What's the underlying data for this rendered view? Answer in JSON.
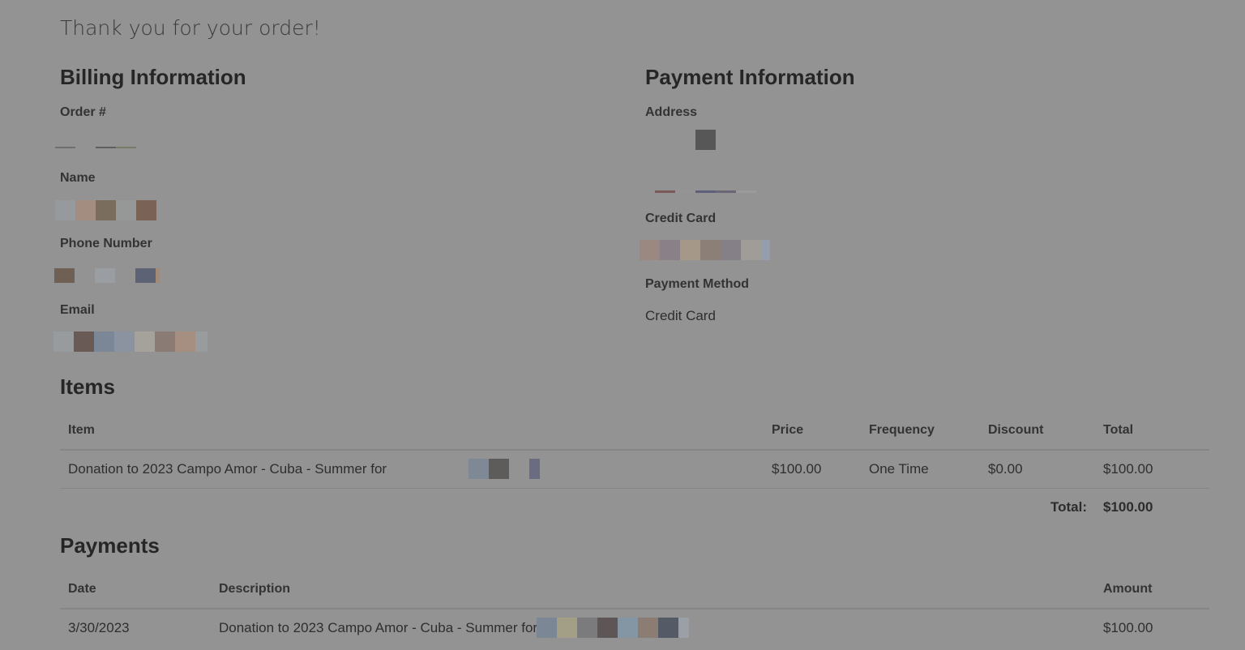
{
  "header": {
    "thanks": "Thank you for your order!"
  },
  "billing": {
    "title": "Billing Information",
    "order_label": "Order #",
    "name_label": "Name",
    "phone_label": "Phone Number",
    "email_label": "Email"
  },
  "payment": {
    "title": "Payment Information",
    "address_label": "Address",
    "card_label": "Credit Card",
    "method_label": "Payment Method",
    "method_value": "Credit Card"
  },
  "items": {
    "title": "Items",
    "columns": [
      "Item",
      "Price",
      "Frequency",
      "Discount",
      "Total"
    ],
    "rows": [
      {
        "item": "Donation to 2023 Campo Amor - Cuba - Summer for",
        "price": "$100.00",
        "frequency": "One Time",
        "discount": "$0.00",
        "total": "$100.00"
      }
    ],
    "total_label": "Total:",
    "total_value": "$100.00"
  },
  "payments": {
    "title": "Payments",
    "columns": [
      "Date",
      "Description",
      "Amount"
    ],
    "rows": [
      {
        "date": "3/30/2023",
        "description": "Donation to 2023 Campo Amor - Cuba - Summer for",
        "amount": "$100.00"
      }
    ]
  }
}
